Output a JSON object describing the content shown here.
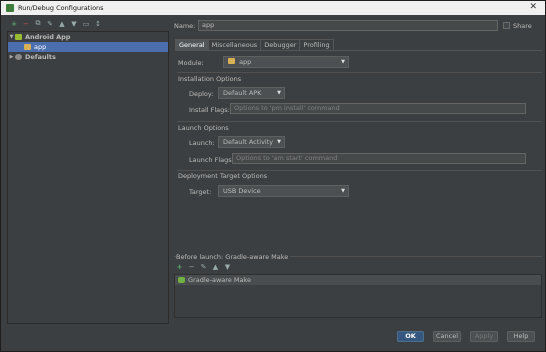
{
  "window": {
    "title": "Run/Debug Configurations",
    "close_glyph": "✕"
  },
  "left_toolbar": {
    "icons": [
      "add-icon",
      "remove-icon",
      "copy-icon",
      "edit-defaults-icon",
      "move-up-icon",
      "move-down-icon",
      "folder-icon",
      "sort-icon"
    ],
    "glyphs": [
      "+",
      "−",
      "⧉",
      "✎",
      "▲",
      "▼",
      "▭",
      "↕"
    ]
  },
  "tree": {
    "items": [
      {
        "label": "Android App",
        "expanded": true,
        "level": 0,
        "icon": "android-icon"
      },
      {
        "label": "app",
        "level": 1,
        "selected": true,
        "icon": "folder-icon"
      },
      {
        "label": "Defaults",
        "expanded": false,
        "level": 0,
        "icon": "gear-icon"
      }
    ],
    "expanded_glyph": "▼",
    "collapsed_glyph": "▶"
  },
  "name_row": {
    "label": "Name:",
    "value": "app",
    "share_label": "Share",
    "share_checked": false
  },
  "tabs": [
    "General",
    "Miscellaneous",
    "Debugger",
    "Profiling"
  ],
  "active_tab": "General",
  "general": {
    "module_label": "Module:",
    "module_value": "app",
    "installation_options": "Installation Options",
    "deploy_label": "Deploy:",
    "deploy_value": "Default APK",
    "install_flags_label": "Install Flags:",
    "install_flags_placeholder": "Options to 'pm install' command",
    "launch_options": "Launch Options",
    "launch_label": "Launch:",
    "launch_value": "Default Activity",
    "launch_flags_label": "Launch Flags:",
    "launch_flags_placeholder": "Options to 'am start' command",
    "deployment_target_options": "Deployment Target Options",
    "target_label": "Target:",
    "target_value": "USB Device",
    "dropdown_glyph": "▼"
  },
  "before_launch": {
    "header": "Before launch: Gradle-aware Make",
    "toolbar_glyphs": [
      "+",
      "−",
      "✎",
      "▲",
      "▼"
    ],
    "tasks": [
      "Gradle-aware Make"
    ]
  },
  "buttons": {
    "ok": "OK",
    "cancel": "Cancel",
    "apply": "Apply",
    "help": "Help"
  },
  "colors": {
    "background": "#3c3f41",
    "selection": "#4b6eaf",
    "ok_button": "#365880"
  }
}
